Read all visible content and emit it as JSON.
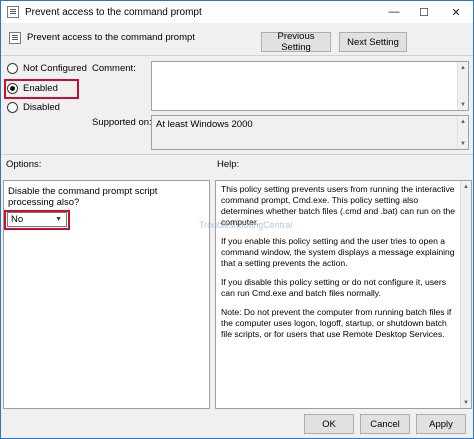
{
  "window": {
    "title": "Prevent access to the command prompt",
    "controls": {
      "minimize": "—",
      "maximize": "☐",
      "close": "✕"
    }
  },
  "header": {
    "setting_name": "Prevent access to the command prompt",
    "previous_label": "Previous Setting",
    "next_label": "Next Setting"
  },
  "state": {
    "not_configured": "Not Configured",
    "enabled": "Enabled",
    "disabled": "Disabled",
    "selected": "enabled"
  },
  "comment": {
    "label": "Comment:",
    "value": ""
  },
  "supported_on": {
    "label": "Supported on:",
    "value": "At least Windows 2000"
  },
  "options": {
    "label": "Options:",
    "question": "Disable the command prompt script processing also?",
    "select_value": "No"
  },
  "help": {
    "label": "Help:",
    "paragraphs": [
      "This policy setting prevents users from running the interactive command prompt, Cmd.exe.  This policy setting also determines whether batch files (.cmd and .bat) can run on the computer.",
      "If you enable this policy setting and the user tries to open a command window, the system displays a message explaining that a setting prevents the action.",
      "If you disable this policy setting or do not configure it, users can run Cmd.exe and batch files normally.",
      "Note: Do not prevent the computer from running batch files if the computer uses logon, logoff, startup, or shutdown batch file scripts, or for users that use Remote Desktop Services."
    ]
  },
  "watermark": "TroubleshootingCentral",
  "footer": {
    "ok": "OK",
    "cancel": "Cancel",
    "apply": "Apply"
  },
  "colors": {
    "highlight": "#c8102e",
    "title_border": "#2b76c8"
  }
}
